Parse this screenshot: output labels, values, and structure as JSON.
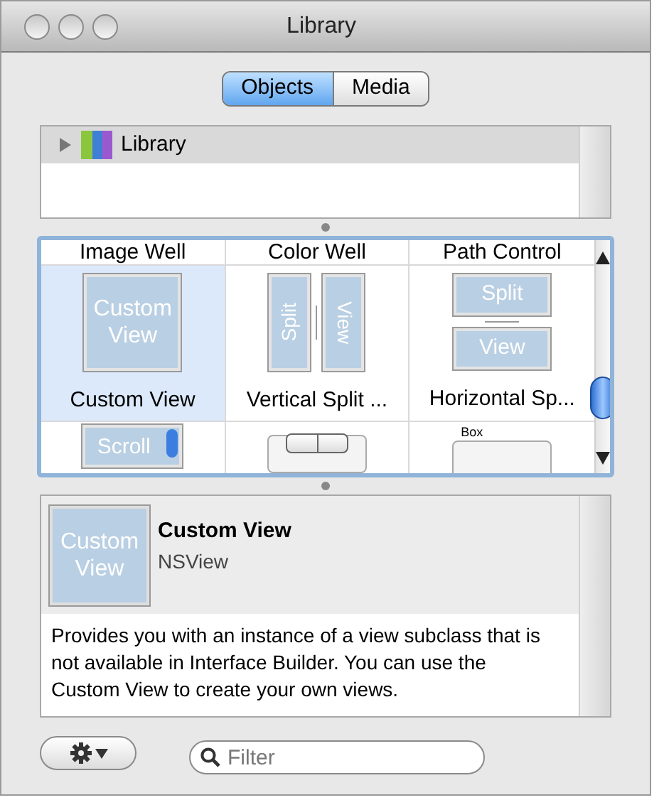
{
  "window": {
    "title": "Library"
  },
  "tabs": [
    {
      "label": "Objects",
      "selected": true
    },
    {
      "label": "Media",
      "selected": false
    }
  ],
  "outline": {
    "items": [
      {
        "label": "Library",
        "expanded": false
      }
    ]
  },
  "grid": {
    "items": [
      {
        "kind": "label",
        "label": "Image Well",
        "selected": false
      },
      {
        "kind": "label",
        "label": "Color Well",
        "selected": false
      },
      {
        "kind": "label",
        "label": "Path Control",
        "selected": false
      },
      {
        "kind": "custom",
        "label": "Custom View",
        "icon_text": [
          "Custom",
          "View"
        ],
        "selected": true
      },
      {
        "kind": "vsplit",
        "label": "Vertical Split ...",
        "icon_text": [
          "Split",
          "View"
        ],
        "selected": false
      },
      {
        "kind": "hsplit",
        "label": "Horizontal Sp...",
        "icon_text": [
          "Split",
          "View"
        ],
        "selected": false
      },
      {
        "kind": "scroll",
        "icon_text": [
          "Scroll"
        ],
        "selected": false
      },
      {
        "kind": "segmented",
        "selected": false
      },
      {
        "kind": "box",
        "icon_text": [
          "Box"
        ],
        "selected": false
      }
    ]
  },
  "detail": {
    "icon_text": [
      "Custom",
      "View"
    ],
    "title": "Custom View",
    "class_name": "NSView",
    "description": "Provides you with an instance of a view subclass that is not available in Interface Builder.  You can use the Custom View to create your own views."
  },
  "filter": {
    "placeholder": "Filter"
  }
}
